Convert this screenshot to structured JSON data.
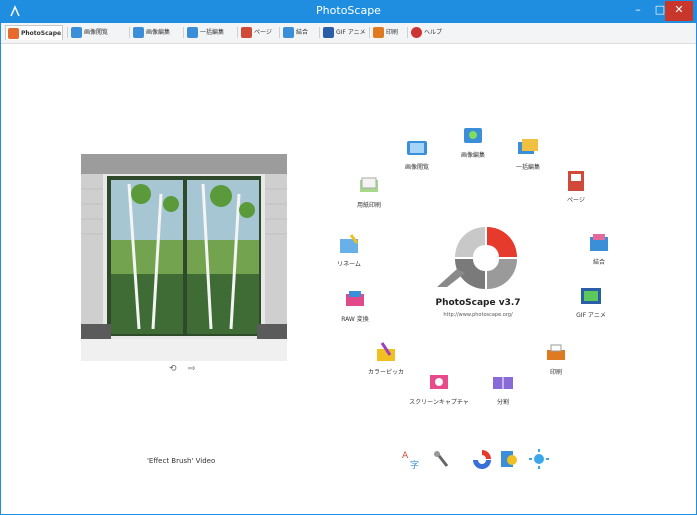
{
  "window": {
    "title": "PhotoScape",
    "buttons": {
      "minimize": "–",
      "maximize": "□",
      "close": "✕"
    }
  },
  "tabs": [
    {
      "label": "PhotoScape",
      "active": true,
      "icon": "app-icon",
      "color": "#e66a2c"
    },
    {
      "label": "画像閲覧",
      "icon": "viewer-icon",
      "color": "#3a8fd8"
    },
    {
      "label": "画像編集",
      "icon": "editor-icon",
      "color": "#3a8fd8"
    },
    {
      "label": "一括編集",
      "icon": "batch-icon",
      "color": "#3a8fd8"
    },
    {
      "label": "ページ",
      "icon": "page-icon",
      "color": "#d04a3a"
    },
    {
      "label": "結合",
      "icon": "combine-icon",
      "color": "#3a8fd8"
    },
    {
      "label": "GIF アニメ",
      "icon": "gif-icon",
      "color": "#2a5fa8"
    },
    {
      "label": "印刷",
      "icon": "print-icon",
      "color": "#e07a20"
    },
    {
      "label": "ヘルプ",
      "icon": "help-icon",
      "color": "#cc3333"
    }
  ],
  "home": {
    "brand": "PhotoScape v3.7",
    "url": "http://www.photoscape.org/",
    "caption": "'Effect Brush' Video",
    "photo_nav": {
      "prev": "⟲",
      "next": "⇨"
    },
    "ring": [
      {
        "label": "画像閲覧",
        "icon": "viewer-icon"
      },
      {
        "label": "画像編集",
        "icon": "editor-icon"
      },
      {
        "label": "一括編集",
        "icon": "batch-icon"
      },
      {
        "label": "ページ",
        "icon": "page-icon"
      },
      {
        "label": "結合",
        "icon": "combine-icon"
      },
      {
        "label": "GIF アニメ",
        "icon": "gif-icon"
      },
      {
        "label": "印刷",
        "icon": "print-icon"
      },
      {
        "label": "分割",
        "icon": "splitter-icon"
      },
      {
        "label": "スクリーンキャプチャ",
        "icon": "screen-capture-icon"
      },
      {
        "label": "カラーピッカ",
        "icon": "color-picker-icon"
      },
      {
        "label": "RAW 変換",
        "icon": "raw-converter-icon"
      },
      {
        "label": "リネーム",
        "icon": "rename-icon"
      },
      {
        "label": "用紙印刷",
        "icon": "paper-print-icon"
      }
    ],
    "tools": [
      {
        "icon": "language-icon"
      },
      {
        "icon": "settings-icon"
      },
      {
        "icon": "photoscape-logo-icon"
      },
      {
        "icon": "face-search-icon"
      },
      {
        "icon": "brightness-icon"
      }
    ]
  }
}
